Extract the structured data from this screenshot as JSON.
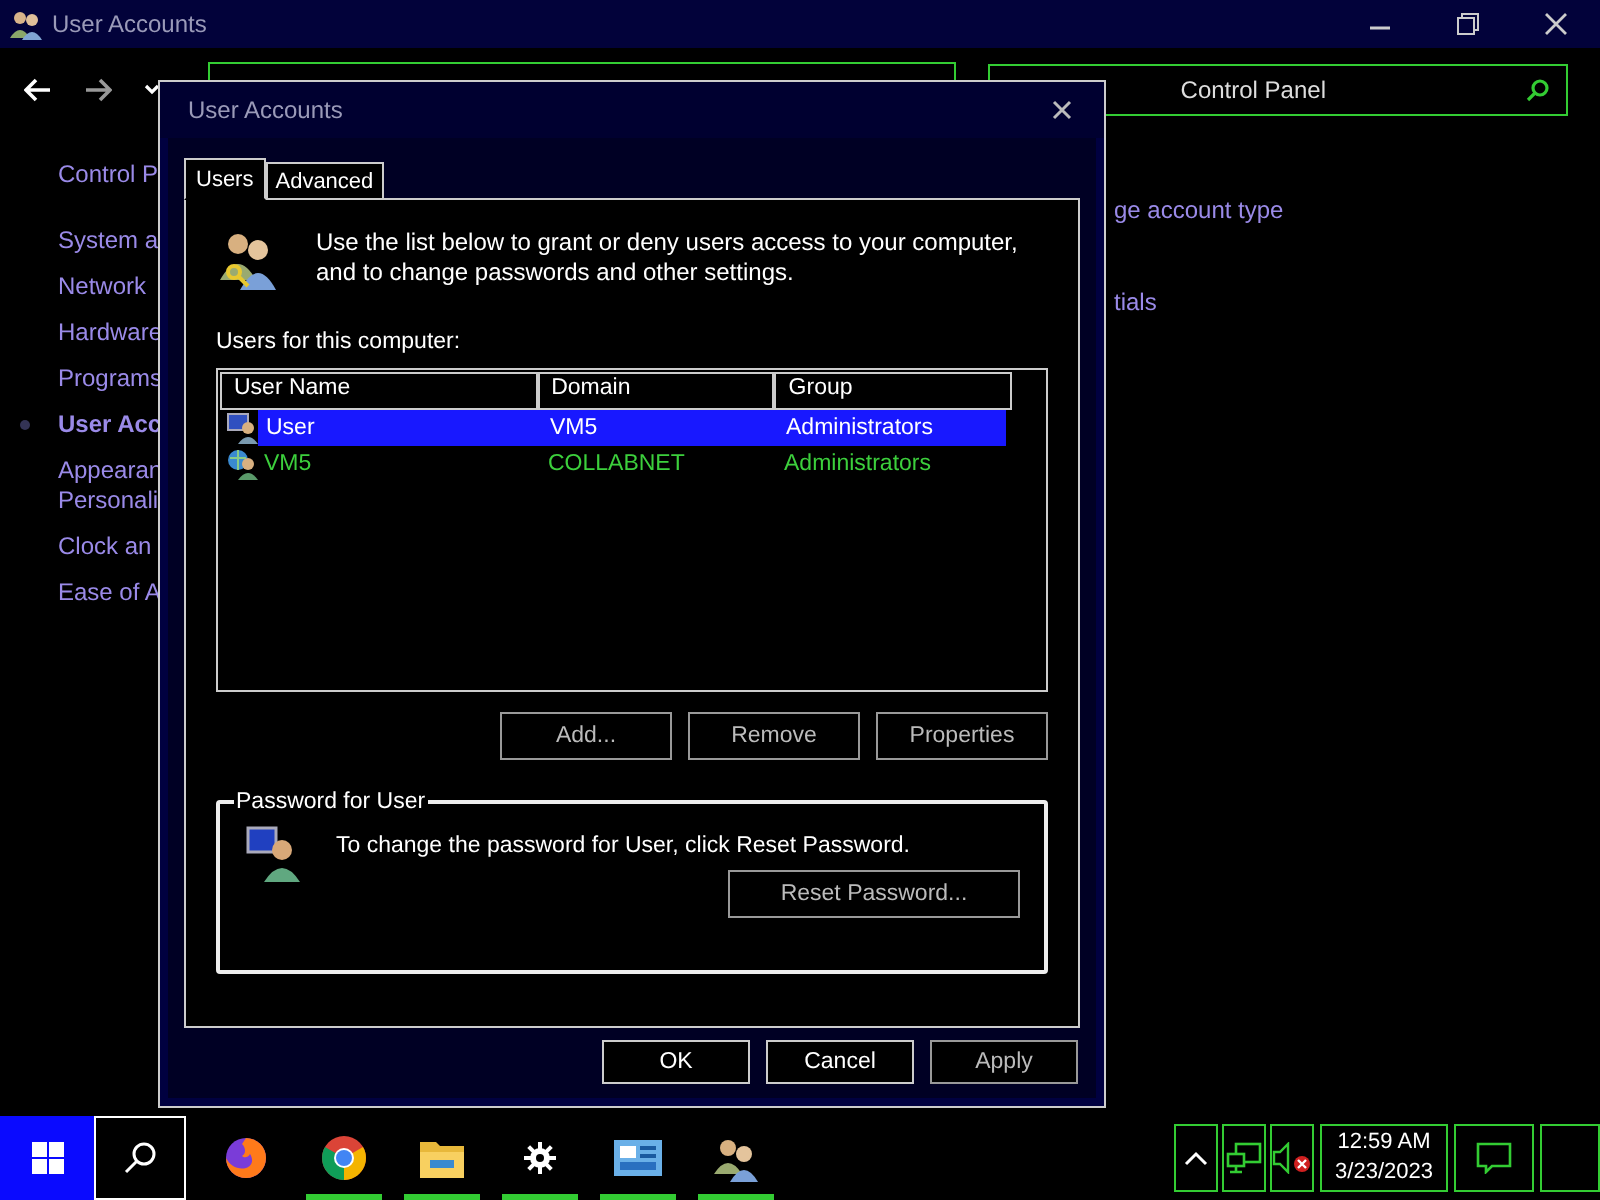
{
  "window": {
    "title": "User Accounts"
  },
  "search": {
    "placeholder": "Control Panel"
  },
  "sidebar": {
    "items": [
      {
        "label": "Control P",
        "selected": false
      },
      {
        "label": "System a",
        "selected": false
      },
      {
        "label": "Network",
        "selected": false
      },
      {
        "label": "Hardware",
        "selected": false
      },
      {
        "label": "Programs",
        "selected": false
      },
      {
        "label": "User Acc",
        "selected": true
      },
      {
        "label": "Appearan\nPersonali",
        "selected": false
      },
      {
        "label": "Clock an",
        "selected": false
      },
      {
        "label": "Ease of A",
        "selected": false
      }
    ]
  },
  "content_links": [
    "ge account type",
    "tials"
  ],
  "dialog": {
    "title": "User Accounts",
    "tabs": [
      {
        "label": "Users",
        "selected": true
      },
      {
        "label": "Advanced",
        "selected": false
      }
    ],
    "intro": "Use the list below to grant or deny users access to your computer, and to change passwords and other settings.",
    "list_label": "Users for this computer:",
    "columns": [
      "User Name",
      "Domain",
      "Group"
    ],
    "rows": [
      {
        "kind": "local",
        "selected": true,
        "cells": [
          "User",
          "VM5",
          "Administrators"
        ]
      },
      {
        "kind": "domain",
        "selected": false,
        "cells": [
          "VM5",
          "COLLABNET",
          "Administrators"
        ]
      }
    ],
    "list_buttons": [
      "Add...",
      "Remove",
      "Properties"
    ],
    "password_group": {
      "title": "Password for User",
      "text": "To change the password for User, click Reset Password.",
      "button": "Reset Password..."
    },
    "buttons": [
      "OK",
      "Cancel",
      "Apply"
    ]
  },
  "taskbar": {
    "apps": [
      {
        "kind": "firefox",
        "running": false
      },
      {
        "kind": "chrome",
        "running": true
      },
      {
        "kind": "folder",
        "running": true
      },
      {
        "kind": "gear",
        "running": true
      },
      {
        "kind": "panel",
        "running": true
      },
      {
        "kind": "users",
        "running": true
      }
    ],
    "time": "12:59 AM",
    "date": "3/23/2023"
  }
}
